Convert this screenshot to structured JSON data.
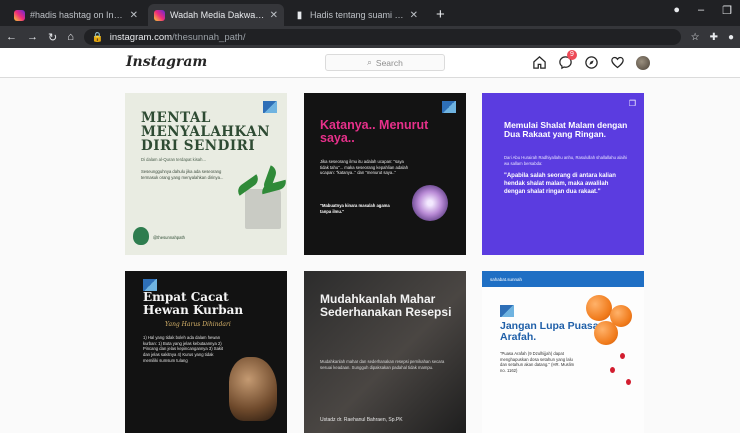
{
  "browser": {
    "tabs": [
      {
        "title": "#hadis hashtag on Instagram • P",
        "active": false,
        "icon": "instagram-icon"
      },
      {
        "title": "Wadah Media Dakwah Sunnah (",
        "active": true,
        "icon": "instagram-icon"
      },
      {
        "title": "Hadis tentang suami dalam kitab",
        "active": false,
        "icon": "book-icon"
      }
    ],
    "url_host": "instagram.com",
    "url_path": "/thesunnah_path/"
  },
  "instagram": {
    "logo": "Instagram",
    "search_placeholder": "Search",
    "notification_count": "9"
  },
  "posts": [
    {
      "title": "MENTAL MENYALAHKAN DIRI SENDIRI",
      "line1": "Di dalam al-Quran terdapat kisah...",
      "line2": "Seseungguhnya dahulu jika ada seseorang termasuk orang yang menyalahkan dirinya...",
      "footer": "@thesunnahpath"
    },
    {
      "title": "Katanya.. Menurut saya..",
      "body": "Jika seseorang ilmu itu adalah ucapan: \"saya tidak tahu\"... maka seseorang kepahlian adalah ucapan: \"katanya..\" dan \"menurut saya..\"",
      "quote": "\"Mabuatnya kinara masalah agama tanpa ilmu.\""
    },
    {
      "title": "Memulai Shalat Malam dengan Dua Rakaat yang Ringan.",
      "body": "Dari Abu Hurairah Radhiyallahu anhu, Rasulullah shallallahu alaihi wa sallam bersabda:",
      "quote": "\"Apabila salah seorang di antara kalian hendak shalat malam, maka awalilah dengan shalat ringan dua rakaat.\""
    },
    {
      "title": "Empat Cacat Hewan Kurban",
      "script": "Yang Harus Dihindari",
      "body": "1) Hal yang tidak boleh ada dalam hewan kurban: 1) Buta yang jelas kebutaannya 2) Pincang dan jelas kepincangannya 3) Sakit dan jelas sakitnya 4) Kurus yang tidak memiliki sumsum tulang"
    },
    {
      "title": "Mudahkanlah Mahar Sederhanakan Resepsi",
      "body": "Mudahkanlah mahar dan sederhanakan resepsi pernikahan secara sesuai keadaan. Sungguh dipaksakan padahal tidak mampu.",
      "footer": "Ustadz dr. Raehanul Bahraen, Sp.PK"
    },
    {
      "title": "Jangan Lupa Puasa Arafah.",
      "topbar": "sahabat.sunnah",
      "body": "\"Puasa Arafah (9 Dzulhijjah) dapat menghapuskan dosa setahun yang lalu dan setahun akan datang.\" (HR. Muslim no. 1162)"
    }
  ],
  "colors": {
    "accent_pink": "#e6308a",
    "accent_purple": "#5b3ce0",
    "accent_blue": "#1f5fa8"
  }
}
